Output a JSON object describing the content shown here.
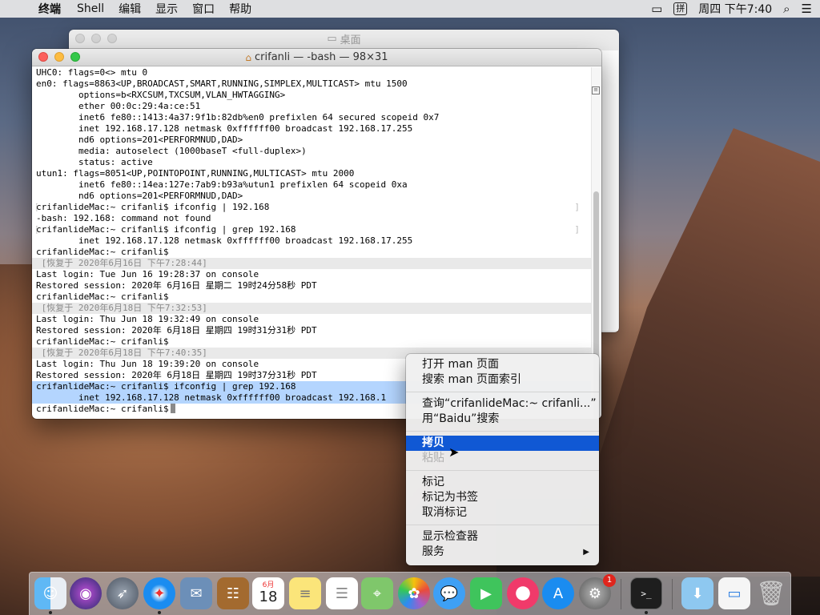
{
  "menubar": {
    "app_name": "终端",
    "items": [
      "Shell",
      "编辑",
      "显示",
      "窗口",
      "帮助"
    ],
    "input_method": "拼",
    "clock": "周四 下午7:40"
  },
  "finder": {
    "title": "桌面"
  },
  "terminal": {
    "title": "crifanli — -bash — 98×31",
    "lines": [
      {
        "text": "UHC0: flags=0<> mtu 0",
        "kind": "normal"
      },
      {
        "text": "en0: flags=8863<UP,BROADCAST,SMART,RUNNING,SIMPLEX,MULTICAST> mtu 1500",
        "kind": "normal"
      },
      {
        "text": "        options=b<RXCSUM,TXCSUM,VLAN_HWTAGGING>",
        "kind": "normal"
      },
      {
        "text": "        ether 00:0c:29:4a:ce:51",
        "kind": "normal"
      },
      {
        "text": "        inet6 fe80::1413:4a37:9f1b:82db%en0 prefixlen 64 secured scopeid 0x7",
        "kind": "normal"
      },
      {
        "text": "        inet 192.168.17.128 netmask 0xffffff00 broadcast 192.168.17.255",
        "kind": "normal"
      },
      {
        "text": "        nd6 options=201<PERFORMNUD,DAD>",
        "kind": "normal"
      },
      {
        "text": "        media: autoselect (1000baseT <full-duplex>)",
        "kind": "normal"
      },
      {
        "text": "        status: active",
        "kind": "normal"
      },
      {
        "text": "utun1: flags=8051<UP,POINTOPOINT,RUNNING,MULTICAST> mtu 2000",
        "kind": "normal"
      },
      {
        "text": "        inet6 fe80::14ea:127e:7ab9:b93a%utun1 prefixlen 64 scopeid 0xa",
        "kind": "normal"
      },
      {
        "text": "        nd6 options=201<PERFORMNUD,DAD>",
        "kind": "normal"
      },
      {
        "text": "crifanlideMac:~ crifanli$ ifconfig | 192.168",
        "kind": "prompt"
      },
      {
        "text": "-bash: 192.168: command not found",
        "kind": "normal"
      },
      {
        "text": "crifanlideMac:~ crifanli$ ifconfig | grep 192.168",
        "kind": "prompt"
      },
      {
        "text": "        inet 192.168.17.128 netmask 0xffffff00 broadcast 192.168.17.255",
        "kind": "normal"
      },
      {
        "text": "crifanlideMac:~ crifanli$",
        "kind": "normal"
      },
      {
        "text": " [恢复于 2020年6月16日 下午7:28:44]",
        "kind": "mark"
      },
      {
        "text": "Last login: Tue Jun 16 19:28:37 on console",
        "kind": "normal"
      },
      {
        "text": "Restored session: 2020年 6月16日 星期二 19时24分58秒 PDT",
        "kind": "normal"
      },
      {
        "text": "crifanlideMac:~ crifanli$",
        "kind": "normal"
      },
      {
        "text": " [恢复于 2020年6月18日 下午7:32:53]",
        "kind": "mark"
      },
      {
        "text": "Last login: Thu Jun 18 19:32:49 on console",
        "kind": "normal"
      },
      {
        "text": "Restored session: 2020年 6月18日 星期四 19时31分31秒 PDT",
        "kind": "normal"
      },
      {
        "text": "crifanlideMac:~ crifanli$",
        "kind": "normal"
      },
      {
        "text": " [恢复于 2020年6月18日 下午7:40:35]",
        "kind": "mark"
      },
      {
        "text": "Last login: Thu Jun 18 19:39:20 on console",
        "kind": "normal"
      },
      {
        "text": "Restored session: 2020年 6月18日 星期四 19时37分31秒 PDT",
        "kind": "normal"
      },
      {
        "text": "crifanlideMac:~ crifanli$ ifconfig | grep 192.168",
        "kind": "sel"
      },
      {
        "text": "        inet 192.168.17.128 netmask 0xffffff00 broadcast 192.168.1",
        "kind": "sel"
      },
      {
        "text": "crifanlideMac:~ crifanli$",
        "kind": "cursor"
      }
    ]
  },
  "context_menu": {
    "groups": [
      [
        {
          "label": "打开 man 页面",
          "state": "normal"
        },
        {
          "label": "搜索 man 页面索引",
          "state": "normal"
        }
      ],
      [
        {
          "label": "查询“crifanlideMac:~ crifanli...”",
          "state": "normal"
        },
        {
          "label": "用“Baidu”搜索",
          "state": "normal"
        }
      ],
      [
        {
          "label": "拷贝",
          "state": "active"
        },
        {
          "label": "粘贴",
          "state": "disabled"
        }
      ],
      [
        {
          "label": "标记",
          "state": "normal"
        },
        {
          "label": "标记为书签",
          "state": "normal"
        },
        {
          "label": "取消标记",
          "state": "normal"
        }
      ],
      [
        {
          "label": "显示检查器",
          "state": "normal"
        },
        {
          "label": "服务",
          "state": "normal",
          "submenu": true
        }
      ]
    ]
  },
  "dock": {
    "calendar_month": "6月",
    "calendar_day": "18",
    "prefs_badge": "1"
  },
  "colors": {
    "selection": "#b4d5fe",
    "menu_highlight": "#1058d4"
  }
}
